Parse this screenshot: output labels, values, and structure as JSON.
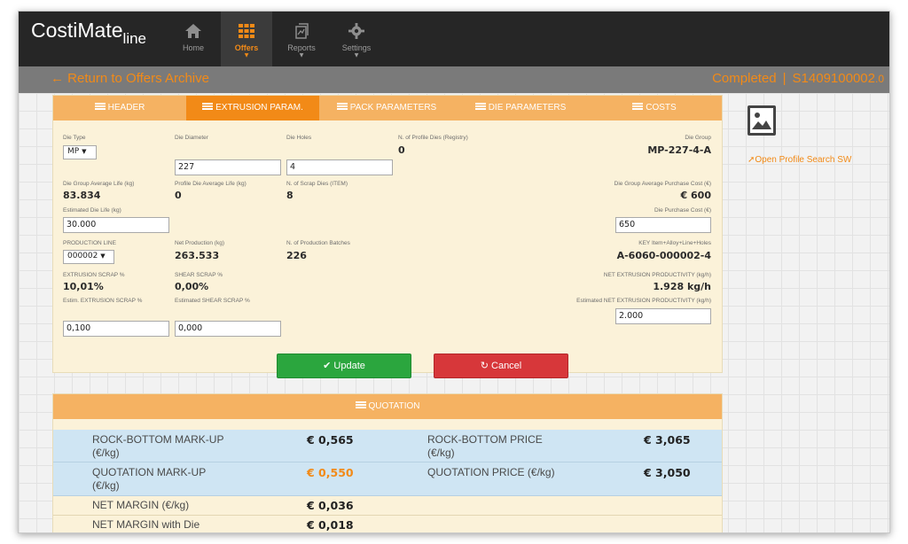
{
  "app": {
    "name": "CostiMate",
    "name_sub": "line"
  },
  "nav": [
    {
      "label": "Home",
      "icon": "home-icon"
    },
    {
      "label": "Offers",
      "icon": "grid-icon",
      "active": true
    },
    {
      "label": "Reports",
      "icon": "reports-icon"
    },
    {
      "label": "Settings",
      "icon": "gear-icon"
    }
  ],
  "subbar": {
    "return_label": "Return to Offers Archive",
    "status": "Completed",
    "separator": "|",
    "offer_code": "S1409100002",
    "offer_version": ".0"
  },
  "tabs": [
    "HEADER",
    "EXTRUSION PARAM.",
    "PACK PARAMETERS",
    "DIE PARAMETERS",
    "COSTS"
  ],
  "form": {
    "die_type": {
      "label": "Die Type",
      "value": "MP"
    },
    "die_diameter": {
      "label": "Die Diameter",
      "value": "227"
    },
    "die_holes": {
      "label": "Die Holes",
      "value": "4"
    },
    "n_profile_dies": {
      "label": "N. of Profile Dies (Registry)",
      "value": "0"
    },
    "die_group": {
      "label": "Die Group",
      "value": "MP-227-4-A"
    },
    "die_group_avg_life": {
      "label": "Die Group Average Life (kg)",
      "value": "83.834"
    },
    "profile_die_avg_life": {
      "label": "Profile Die Average Life (kg)",
      "value": "0"
    },
    "n_scrap_dies": {
      "label": "N. of Scrap Dies (ITEM)",
      "value": "8"
    },
    "die_group_avg_cost": {
      "label": "Die Group Average Purchase Cost (€)",
      "value": "€ 600"
    },
    "estimated_die_life": {
      "label": "Estimated Die Life (kg)",
      "value": "30.000"
    },
    "die_purchase_cost": {
      "label": "Die Purchase Cost (€)",
      "value": "650"
    },
    "production_line": {
      "label": "PRODUCTION LINE",
      "value": "000002"
    },
    "net_production": {
      "label": "Net Production (kg)",
      "value": "263.533"
    },
    "n_batches": {
      "label": "N. of Production Batches",
      "value": "226"
    },
    "key_item": {
      "label": "KEY Item+Alloy+Line+Holes",
      "value": "A-6060-000002-4"
    },
    "extrusion_scrap": {
      "label": "EXTRUSION SCRAP %",
      "value": "10,01%"
    },
    "shear_scrap": {
      "label": "SHEAR SCRAP %",
      "value": "0,00%"
    },
    "net_productivity": {
      "label": "NET EXTRUSION PRODUCTIVITY (kg/h)",
      "value": "1.928 kg/h"
    },
    "est_extrusion_scrap": {
      "label": "Estim. EXTRUSION SCRAP %",
      "value": "0,100"
    },
    "est_shear_scrap": {
      "label": "Estimated SHEAR SCRAP %",
      "value": "0,000"
    },
    "est_net_productivity": {
      "label": "Estimated NET EXTRUSION PRODUCTIVITY (kg/h)",
      "value": "2.000"
    }
  },
  "buttons": {
    "update": "✔ Update",
    "cancel": "↻ Cancel"
  },
  "side": {
    "open_link": "Open Profile Search SW"
  },
  "quotation": {
    "title": "QUOTATION",
    "rows": [
      {
        "label": "ROCK-BOTTOM MARK-UP (€/kg)",
        "value": "€ 0,565",
        "label2": "ROCK-BOTTOM PRICE (€/kg)",
        "value2": "€ 3,065"
      },
      {
        "label": "QUOTATION MARK-UP (€/kg)",
        "value": "€ 0,550",
        "label2": "QUOTATION PRICE (€/kg)",
        "value2": "€ 3,050"
      },
      {
        "label": "NET MARGIN (€/kg)",
        "value": "€ 0,036"
      },
      {
        "label": "NET MARGIN with Die",
        "value": "€ 0,018"
      }
    ]
  }
}
